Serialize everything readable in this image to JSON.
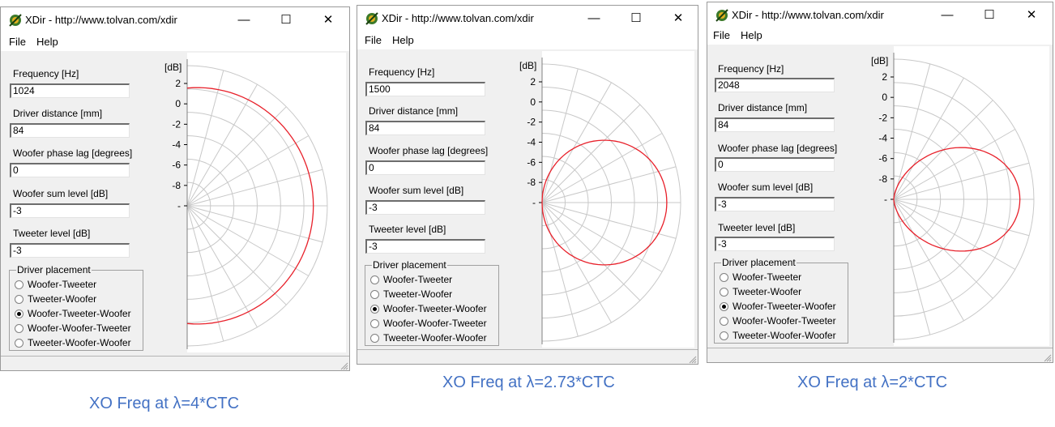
{
  "windows": [
    {
      "title": "XDir - http://www.tolvan.com/xdir",
      "controls": {
        "minimize": "—",
        "maximize": "☐",
        "close": "✕"
      },
      "menu": [
        "File",
        "Help"
      ],
      "fields": [
        {
          "label": "Frequency [Hz]",
          "value": "1024"
        },
        {
          "label": "Driver distance [mm]",
          "value": "84"
        },
        {
          "label": "Woofer phase lag [degrees]",
          "value": "0"
        },
        {
          "label": "Woofer sum level [dB]",
          "value": "-3"
        },
        {
          "label": "Tweeter level [dB]",
          "value": "-3"
        }
      ],
      "placement": {
        "title": "Driver placement",
        "options": [
          "Woofer-Tweeter",
          "Tweeter-Woofer",
          "Woofer-Tweeter-Woofer",
          "Woofer-Woofer-Tweeter",
          "Tweeter-Woofer-Woofer"
        ],
        "selected": 2
      },
      "plot": {
        "unit": "[dB]",
        "ticks": [
          "2",
          "0",
          "-2",
          "-4",
          "-6",
          "-8",
          "-"
        ],
        "curve": "wide"
      }
    },
    {
      "title": "XDir - http://www.tolvan.com/xdir",
      "controls": {
        "minimize": "—",
        "maximize": "☐",
        "close": "✕"
      },
      "menu": [
        "File",
        "Help"
      ],
      "fields": [
        {
          "label": "Frequency [Hz]",
          "value": "1500"
        },
        {
          "label": "Driver distance [mm]",
          "value": "84"
        },
        {
          "label": "Woofer phase lag [degrees]",
          "value": "0"
        },
        {
          "label": "Woofer sum level [dB]",
          "value": "-3"
        },
        {
          "label": "Tweeter level [dB]",
          "value": "-3"
        }
      ],
      "placement": {
        "title": "Driver placement",
        "options": [
          "Woofer-Tweeter",
          "Tweeter-Woofer",
          "Woofer-Tweeter-Woofer",
          "Woofer-Woofer-Tweeter",
          "Tweeter-Woofer-Woofer"
        ],
        "selected": 2
      },
      "plot": {
        "unit": "[dB]",
        "ticks": [
          "2",
          "0",
          "-2",
          "-4",
          "-6",
          "-8",
          "-"
        ],
        "curve": "medium"
      }
    },
    {
      "title": "XDir - http://www.tolvan.com/xdir",
      "controls": {
        "minimize": "—",
        "maximize": "☐",
        "close": "✕"
      },
      "menu": [
        "File",
        "Help"
      ],
      "fields": [
        {
          "label": "Frequency [Hz]",
          "value": "2048"
        },
        {
          "label": "Driver distance [mm]",
          "value": "84"
        },
        {
          "label": "Woofer phase lag [degrees]",
          "value": "0"
        },
        {
          "label": "Woofer sum level [dB]",
          "value": "-3"
        },
        {
          "label": "Tweeter level [dB]",
          "value": "-3"
        }
      ],
      "placement": {
        "title": "Driver placement",
        "options": [
          "Woofer-Tweeter",
          "Tweeter-Woofer",
          "Woofer-Tweeter-Woofer",
          "Woofer-Woofer-Tweeter",
          "Tweeter-Woofer-Woofer"
        ],
        "selected": 2
      },
      "plot": {
        "unit": "[dB]",
        "ticks": [
          "2",
          "0",
          "-2",
          "-4",
          "-6",
          "-8",
          "-"
        ],
        "curve": "narrow"
      }
    }
  ],
  "captions": [
    "XO Freq  at λ=4*CTC",
    "XO Freq  at λ=2.73*CTC",
    "XO Freq  at λ=2*CTC"
  ],
  "colors": {
    "curve": "#e8202a",
    "grid": "#c8c8c8",
    "caption": "#4472c4"
  }
}
